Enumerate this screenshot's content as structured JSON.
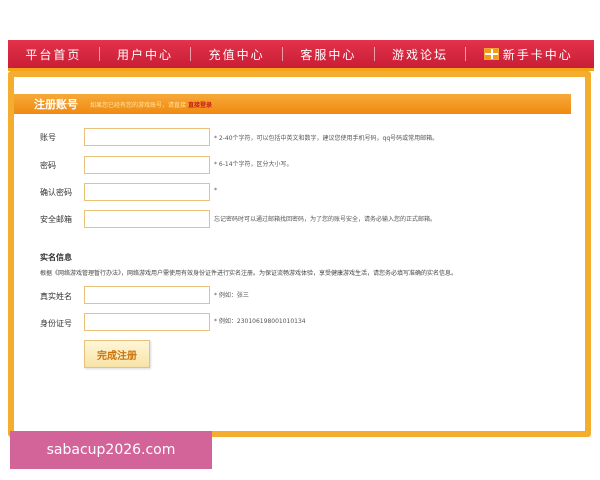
{
  "nav": {
    "items": [
      "平台首页",
      "用户中心",
      "充值中心",
      "客服中心",
      "游戏论坛"
    ],
    "newbie_label": "新手卡中心",
    "gift_icon": "gift-icon"
  },
  "form": {
    "title": "注册账号",
    "hint": "如果您已经有您的游戏账号，请直接",
    "login_link": "直接登录",
    "fields": [
      {
        "label": "账号",
        "tip": "* 2-40个字符，可以包括中英文和数字，建议您使用手机号码，qq号码或常用邮箱。"
      },
      {
        "label": "密码",
        "tip": "* 6-14个字符，区分大小写。"
      },
      {
        "label": "确认密码",
        "tip": "*"
      },
      {
        "label": "安全邮箱",
        "tip": "忘记密码时可以通过邮箱找回密码，为了您的账号安全，请务必输入您的正式邮箱。"
      }
    ],
    "realname": {
      "title": "实名信息",
      "desc": "根据《网络游戏管理暂行办法》，网络游戏用户需使用有效身份证件进行实名注册。为保证流畅游戏体验，享受健康游戏生活，请您务必填写准确的实名信息。",
      "fields": [
        {
          "label": "真实姓名",
          "tip": "* 例如：张三"
        },
        {
          "label": "身份证号",
          "tip": "* 例如：230106198001010134"
        }
      ]
    },
    "submit_label": "完成注册"
  },
  "watermark": "sabacup2026.com",
  "colors": {
    "nav_red": "#d42840",
    "panel_orange": "#f5ad2f",
    "title_orange": "#f29a22",
    "submit_text": "#c8720c",
    "watermark_pink": "#d3649a"
  }
}
